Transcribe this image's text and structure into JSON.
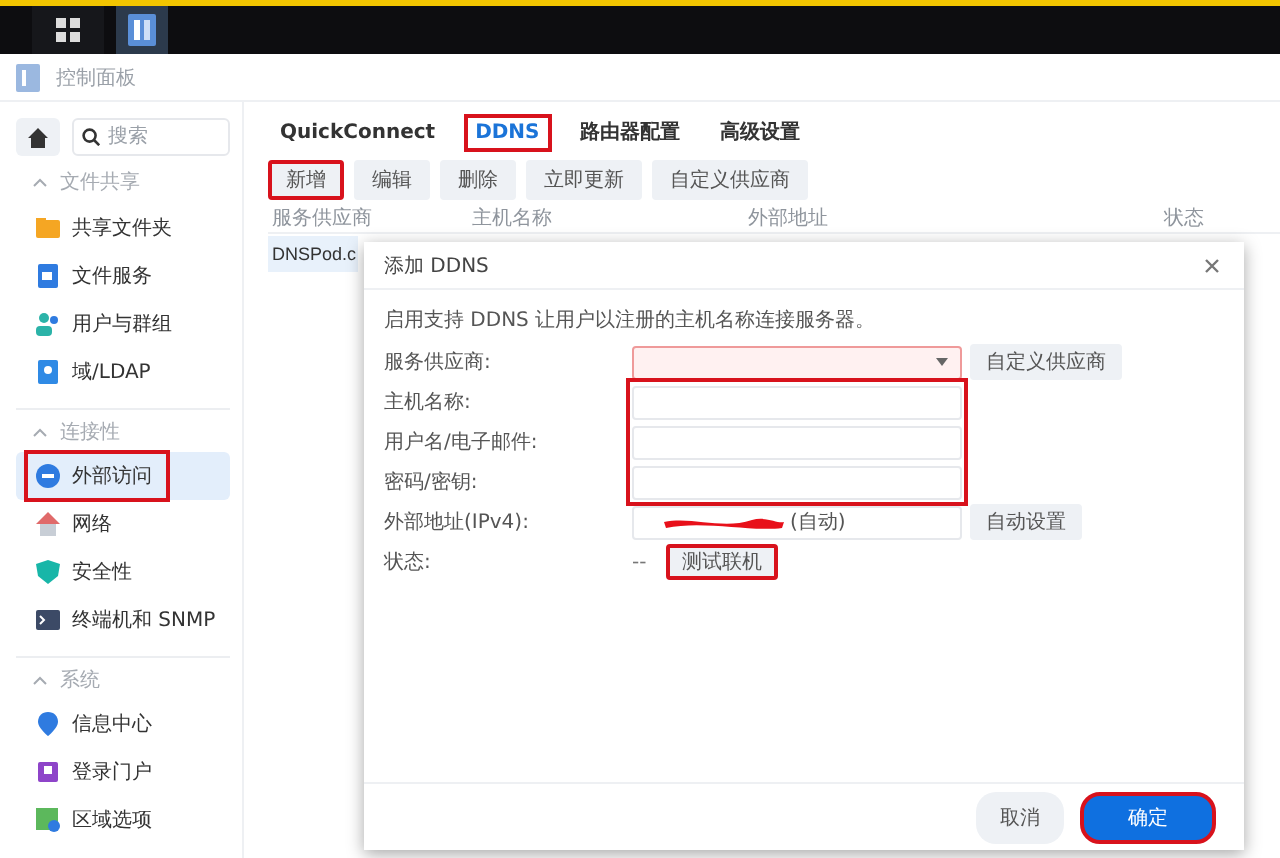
{
  "window": {
    "title": "控制面板"
  },
  "sidebar": {
    "search": {
      "placeholder": "搜索"
    },
    "groups": [
      {
        "label": "文件共享",
        "expanded": true,
        "items": [
          {
            "label": "共享文件夹",
            "selected": false,
            "highlighted": false
          },
          {
            "label": "文件服务",
            "selected": false,
            "highlighted": false
          },
          {
            "label": "用户与群组",
            "selected": false,
            "highlighted": false
          },
          {
            "label": "域/LDAP",
            "selected": false,
            "highlighted": false
          }
        ]
      },
      {
        "label": "连接性",
        "expanded": true,
        "items": [
          {
            "label": "外部访问",
            "selected": true,
            "highlighted": true
          },
          {
            "label": "网络",
            "selected": false,
            "highlighted": false
          },
          {
            "label": "安全性",
            "selected": false,
            "highlighted": false
          },
          {
            "label": "终端机和 SNMP",
            "selected": false,
            "highlighted": false
          }
        ]
      },
      {
        "label": "系统",
        "expanded": true,
        "items": [
          {
            "label": "信息中心",
            "selected": false,
            "highlighted": false
          },
          {
            "label": "登录门户",
            "selected": false,
            "highlighted": false
          },
          {
            "label": "区域选项",
            "selected": false,
            "highlighted": false
          }
        ]
      }
    ]
  },
  "tabs": [
    {
      "label": "QuickConnect",
      "selected": false,
      "highlighted": false
    },
    {
      "label": "DDNS",
      "selected": true,
      "highlighted": true
    },
    {
      "label": "路由器配置",
      "selected": false,
      "highlighted": false
    },
    {
      "label": "高级设置",
      "selected": false,
      "highlighted": false
    }
  ],
  "toolbar": [
    {
      "label": "新增",
      "highlighted": true
    },
    {
      "label": "编辑",
      "highlighted": false
    },
    {
      "label": "删除",
      "highlighted": false
    },
    {
      "label": "立即更新",
      "highlighted": false
    },
    {
      "label": "自定义供应商",
      "highlighted": false
    }
  ],
  "table": {
    "columns": [
      "服务供应商",
      "主机名称",
      "外部地址",
      "状态"
    ],
    "rows": [
      {
        "cells": [
          "DNSPod.c"
        ],
        "selected": true
      }
    ]
  },
  "dialog": {
    "title": "添加 DDNS",
    "description": "启用支持 DDNS 让用户以注册的主机名称连接服务器。",
    "text_fields_highlighted": true,
    "rows": [
      {
        "kind": "select",
        "label": "服务供应商:",
        "invalid": true,
        "button": {
          "label": "自定义供应商",
          "highlighted": false
        }
      },
      {
        "kind": "text",
        "label": "主机名称:"
      },
      {
        "kind": "text",
        "label": "用户名/电子邮件:"
      },
      {
        "kind": "text",
        "label": "密码/密钥:"
      },
      {
        "kind": "address",
        "label": "外部地址(IPv4):",
        "value": "(自动)",
        "redacted": true,
        "button": {
          "label": "自动设置",
          "highlighted": false
        }
      },
      {
        "kind": "status",
        "label": "状态:",
        "value": "--",
        "button": {
          "label": "测试联机",
          "highlighted": true
        }
      }
    ],
    "buttons": [
      {
        "label": "取消",
        "primary": false,
        "highlighted": false
      },
      {
        "label": "确定",
        "primary": true,
        "highlighted": true
      }
    ]
  }
}
